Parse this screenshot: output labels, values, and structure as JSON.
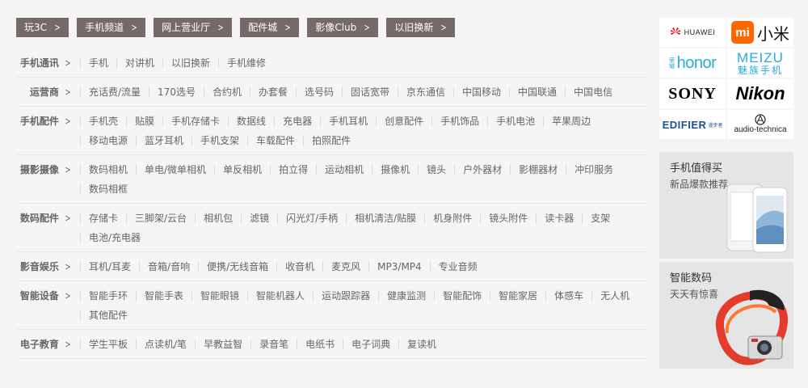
{
  "tabs": [
    "玩3C",
    "手机频道",
    "网上营业厅",
    "配件城",
    "影像Club",
    "以旧换新"
  ],
  "categories": [
    {
      "title": "手机通讯",
      "items": [
        "手机",
        "对讲机",
        "以旧换新",
        "手机维修"
      ]
    },
    {
      "title": "运营商",
      "items": [
        "充话费/流量",
        "170选号",
        "合约机",
        "办套餐",
        "选号码",
        "固话宽带",
        "京东通信",
        "中国移动",
        "中国联通",
        "中国电信"
      ]
    },
    {
      "title": "手机配件",
      "items": [
        "手机壳",
        "贴膜",
        "手机存储卡",
        "数据线",
        "充电器",
        "手机耳机",
        "创意配件",
        "手机饰品",
        "手机电池",
        "苹果周边",
        "移动电源",
        "蓝牙耳机",
        "手机支架",
        "车载配件",
        "拍照配件"
      ]
    },
    {
      "title": "摄影摄像",
      "items": [
        "数码相机",
        "单电/微单相机",
        "单反相机",
        "拍立得",
        "运动相机",
        "摄像机",
        "镜头",
        "户外器材",
        "影棚器材",
        "冲印服务",
        "数码相框"
      ]
    },
    {
      "title": "数码配件",
      "items": [
        "存储卡",
        "三脚架/云台",
        "相机包",
        "滤镜",
        "闪光灯/手柄",
        "相机清洁/贴膜",
        "机身附件",
        "镜头附件",
        "读卡器",
        "支架",
        "电池/充电器"
      ]
    },
    {
      "title": "影音娱乐",
      "items": [
        "耳机/耳麦",
        "音箱/音响",
        "便携/无线音箱",
        "收音机",
        "麦克风",
        "MP3/MP4",
        "专业音频"
      ]
    },
    {
      "title": "智能设备",
      "items": [
        "智能手环",
        "智能手表",
        "智能眼镜",
        "智能机器人",
        "运动跟踪器",
        "健康监测",
        "智能配饰",
        "智能家居",
        "体感车",
        "无人机",
        "其他配件"
      ]
    },
    {
      "title": "电子教育",
      "items": [
        "学生平板",
        "点读机/笔",
        "早教益智",
        "录音笔",
        "电纸书",
        "电子词典",
        "复读机"
      ]
    }
  ],
  "brands": [
    {
      "name": "huawei",
      "text": "HUAWEI",
      "color": "#222222"
    },
    {
      "name": "xiaomi",
      "text": "小米",
      "color": "#ff6700"
    },
    {
      "name": "honor",
      "text": "honor",
      "sub": "荣耀",
      "color": "#27a9e1"
    },
    {
      "name": "meizu",
      "text": "MEIZU",
      "sub": "魅族手机",
      "color": "#29a8e0"
    },
    {
      "name": "sony",
      "text": "SONY",
      "color": "#000000"
    },
    {
      "name": "nikon",
      "text": "Nikon",
      "color": "#000000"
    },
    {
      "name": "edifier",
      "text": "EDIFIER",
      "sub": "漫步者",
      "color": "#1a4f9c"
    },
    {
      "name": "audio-technica",
      "text": "audio-technica",
      "color": "#222222"
    }
  ],
  "promos": [
    {
      "title": "手机值得买",
      "subtitle": "新品爆款推荐"
    },
    {
      "title": "智能数码",
      "subtitle": "天天有惊喜"
    }
  ]
}
